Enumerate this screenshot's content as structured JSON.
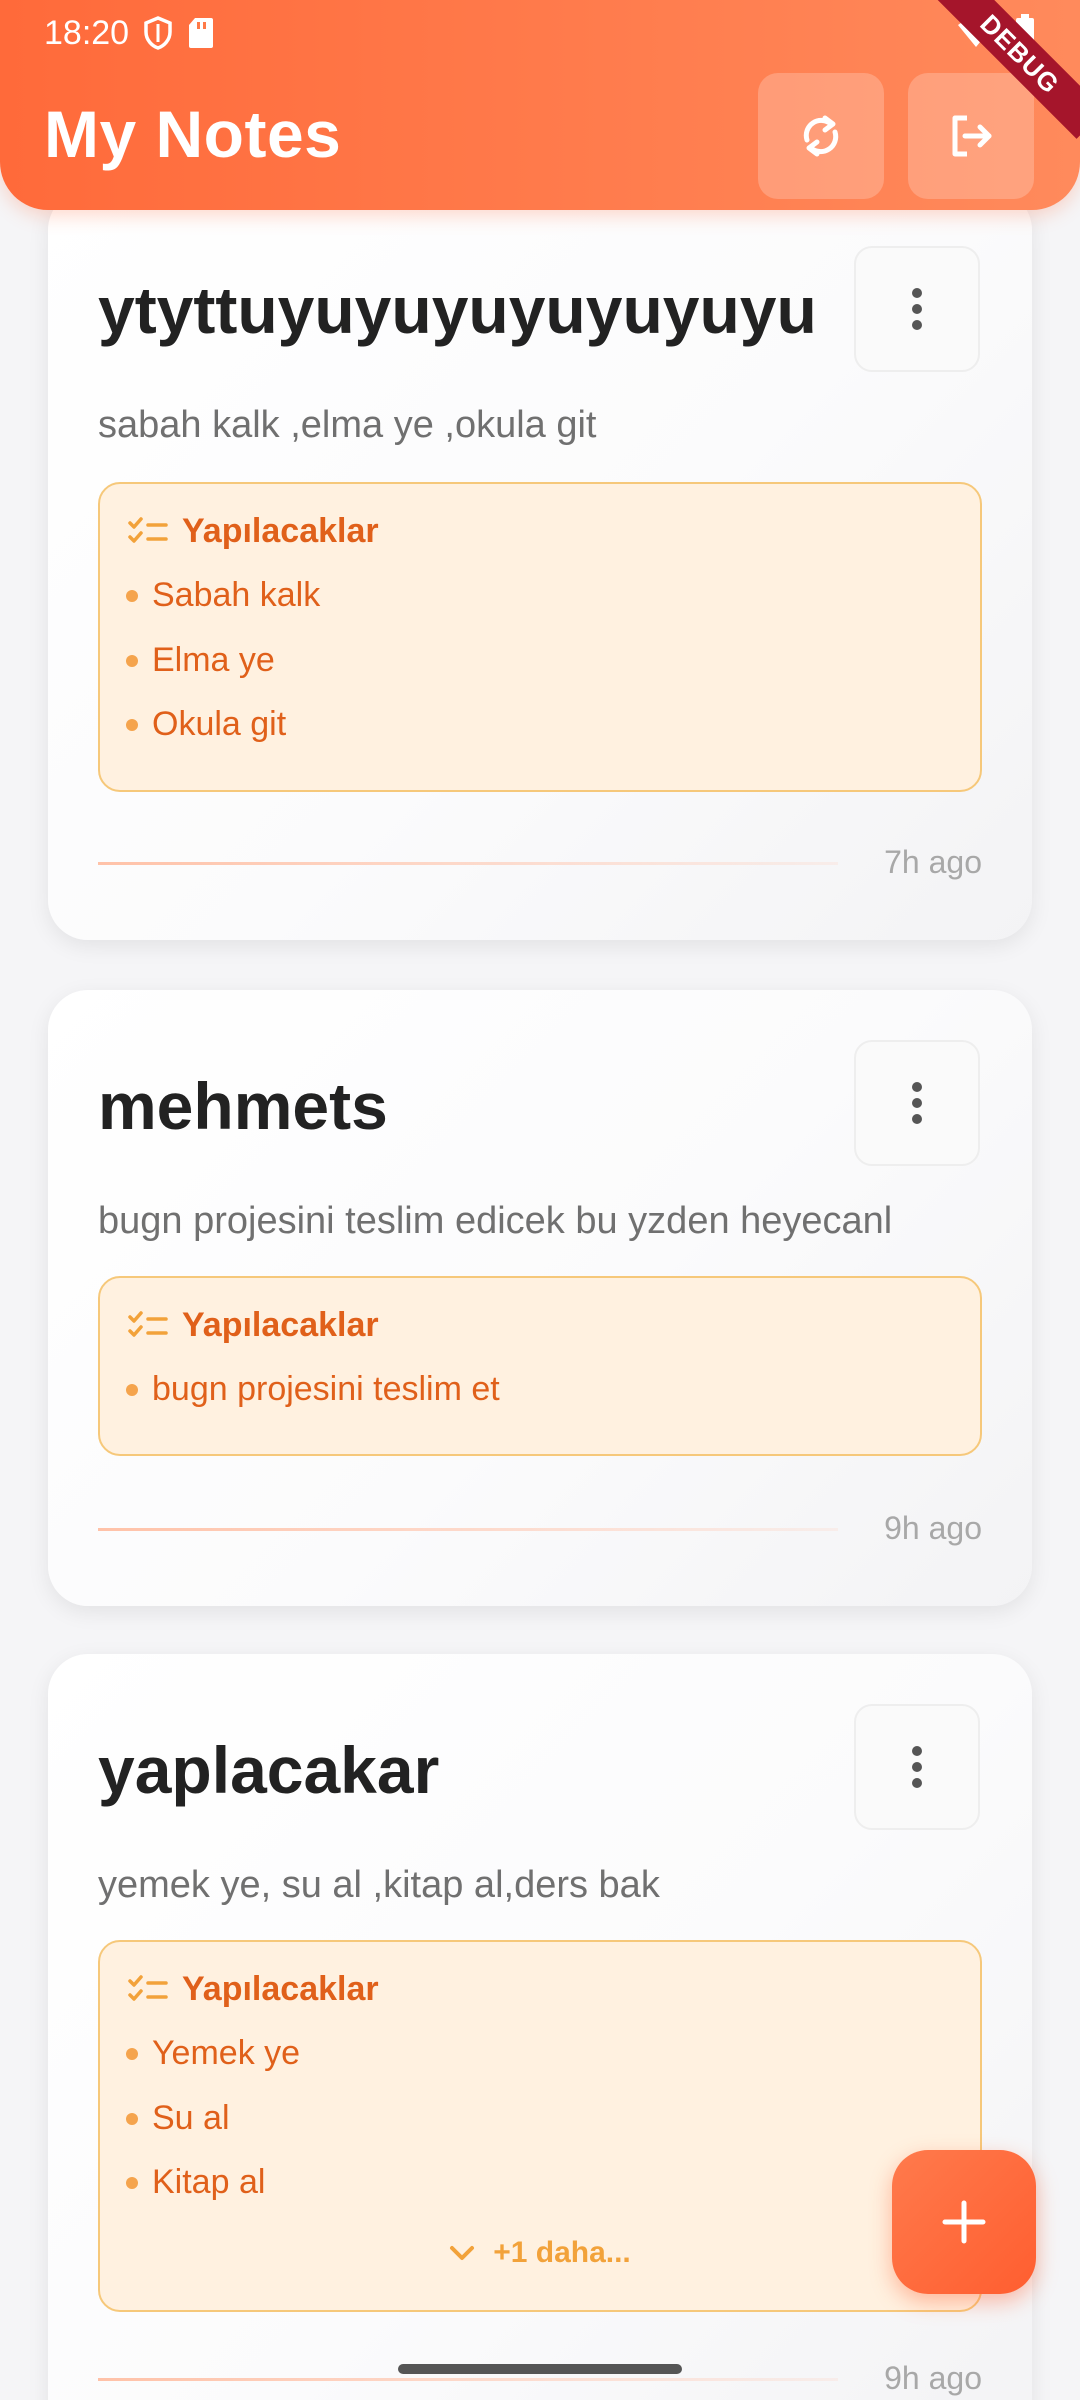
{
  "status": {
    "time": "18:20"
  },
  "app": {
    "title": "My Notes",
    "debug_label": "DEBUG"
  },
  "colors": {
    "accent": "#ff6a3a",
    "todo_bg": "#fff1e0",
    "todo_text": "#e0601a"
  },
  "notes": [
    {
      "title": "ytyttuyuyuyuyuyuyuyu",
      "description": "sabah kalk ,elma ye ,okula git",
      "todo_header": "Yapılacaklar",
      "todos": [
        "Sabah kalk",
        "Elma ye",
        "Okula git"
      ],
      "time": "7h ago"
    },
    {
      "title": "mehmets",
      "description": "bugn projesini teslim edicek bu yzden heyecanl",
      "todo_header": "Yapılacaklar",
      "todos": [
        "bugn projesini teslim et"
      ],
      "time": "9h ago"
    },
    {
      "title": "yaplacakar",
      "description": "yemek ye, su al ,kitap al,ders bak",
      "todo_header": "Yapılacaklar",
      "todos": [
        "Yemek ye",
        "Su al",
        "Kitap al"
      ],
      "more_label": "+1 daha...",
      "time": "9h ago"
    }
  ],
  "icons": {
    "sync": "sync-icon",
    "logout": "logout-icon",
    "menu": "more-vert-icon",
    "checklist": "checklist-icon",
    "add": "add-icon"
  }
}
